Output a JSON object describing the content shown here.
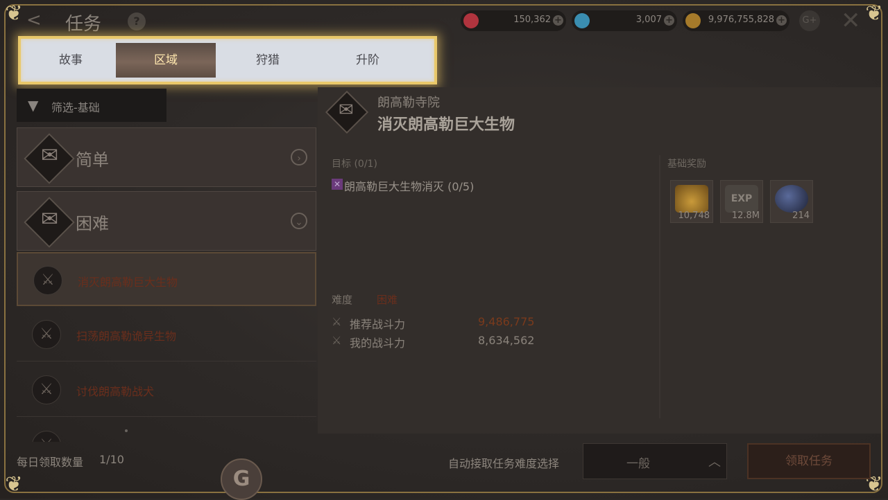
{
  "header": {
    "back_icon": "back-arrow-icon",
    "title": "任务",
    "help": "?",
    "currencies": [
      {
        "icon": "ruby-icon",
        "value": "150,362",
        "color": "#b0343e"
      },
      {
        "icon": "diamond-icon",
        "value": "3,007",
        "color": "#3a8db0"
      },
      {
        "icon": "gold-coin-icon",
        "value": "9,976,755,828",
        "color": "#a57a2a"
      }
    ],
    "plus": "+",
    "g_plus": "G+",
    "close_icon": "close-icon"
  },
  "tabs": [
    {
      "label": "故事",
      "active": false
    },
    {
      "label": "区域",
      "active": true
    },
    {
      "label": "狩猎",
      "active": false
    },
    {
      "label": "升阶",
      "active": false
    }
  ],
  "filter": {
    "label": "筛选-基础"
  },
  "categories": [
    {
      "label": "简单",
      "chevron": "›"
    },
    {
      "label": "困难",
      "chevron": "⌄"
    }
  ],
  "quests": [
    {
      "label": "消灭朗高勒巨大生物",
      "selected": true
    },
    {
      "label": "扫荡朗高勒诡异生物",
      "selected": false
    },
    {
      "label": "讨伐朗高勒战犬",
      "selected": false
    }
  ],
  "daily": {
    "label": "每日领取数量",
    "count": "1/10"
  },
  "g_badge": "G",
  "detail": {
    "location": "朗高勒寺院",
    "title": "消灭朗高勒巨大生物",
    "objective_label": "目标 (0/1)",
    "objective_text": "朗高勒巨大生物消灭 (0/5)",
    "difficulty_label": "难度",
    "difficulty_value": "困难",
    "recommended_power_label": "推荐战斗力",
    "recommended_power_value": "9,486,775",
    "my_power_label": "我的战斗力",
    "my_power_value": "8,634,562"
  },
  "rewards": {
    "label": "基础奖励",
    "items": [
      {
        "icon": "gold-coins-icon",
        "value": "10,748",
        "color": "#8c6a2a"
      },
      {
        "icon": "exp-icon",
        "value": "12.8M",
        "text": "EXP",
        "color": "#4a4540"
      },
      {
        "icon": "orb-icon",
        "value": "214",
        "color": "#2e3550"
      }
    ]
  },
  "footer": {
    "auto_label": "自动接取任务难度选择",
    "select_value": "一般",
    "accept_label": "领取任务"
  }
}
